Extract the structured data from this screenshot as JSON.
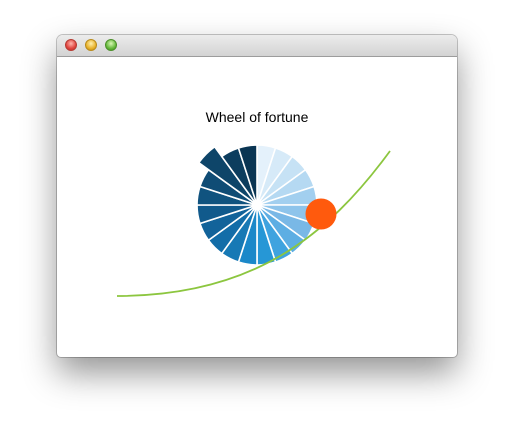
{
  "window": {
    "title": "Wheel of fortune",
    "title_text": "Wheel of fortune"
  },
  "colors": {
    "curve": "#8cc63f",
    "ball": "#ff5a0d",
    "segment_first": "#e3f1fb",
    "segment_last": "#0a3553"
  },
  "wheel": {
    "segment_count": 20,
    "selected_segment": 17,
    "segment_colors": [
      "#e4f1fb",
      "#d6eaf8",
      "#c6e2f5",
      "#b5d9f2",
      "#a2cfef",
      "#8ec4eb",
      "#79b8e6",
      "#5daee3",
      "#3fa3df",
      "#2697d6",
      "#1b88c9",
      "#1779b5",
      "#136da8",
      "#12639a",
      "#115a8c",
      "#10537f",
      "#0f4c75",
      "#0e4569",
      "#0c3d5e",
      "#0a3553"
    ]
  },
  "ball": {
    "shape": "circle"
  }
}
